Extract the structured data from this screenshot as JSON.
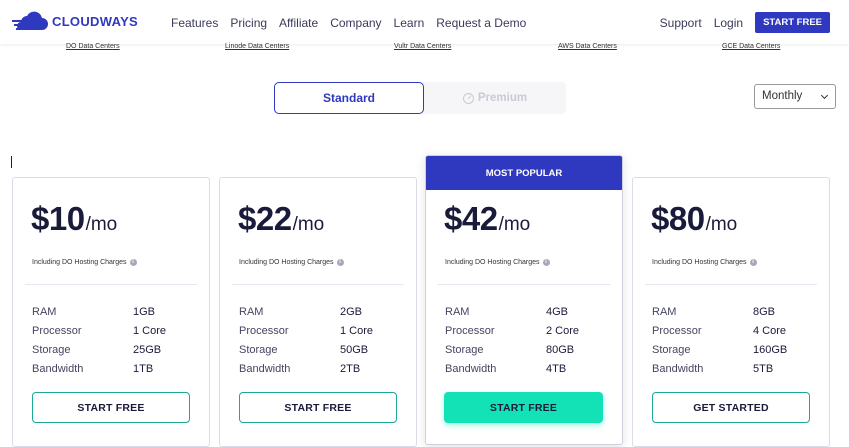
{
  "brand": {
    "name": "CLOUDWAYS",
    "color": "#2f39bf"
  },
  "nav": {
    "links": [
      "Features",
      "Pricing",
      "Affiliate",
      "Company",
      "Learn",
      "Request a Demo"
    ],
    "support": "Support",
    "login": "Login",
    "cta": "START FREE"
  },
  "datacenters": [
    "DO Data Centers",
    "Linode Data Centers",
    "Vultr Data Centers",
    "AWS Data Centers",
    "GCE Data Centers"
  ],
  "plan_toggle": {
    "standard": "Standard",
    "premium": "Premium",
    "premium_icon": "gauge-icon",
    "selected": "Standard"
  },
  "billing": {
    "selected": "Monthly",
    "icon": "chevron-down-icon"
  },
  "colors": {
    "primary": "#2f39bf",
    "accent": "#13e2b6"
  },
  "plans": [
    {
      "price": "$10",
      "unit": "/mo",
      "charges": "Including DO Hosting Charges",
      "specs": [
        [
          "RAM",
          "1GB"
        ],
        [
          "Processor",
          "1 Core"
        ],
        [
          "Storage",
          "25GB"
        ],
        [
          "Bandwidth",
          "1TB"
        ]
      ],
      "button": "START FREE"
    },
    {
      "price": "$22",
      "unit": "/mo",
      "charges": "Including DO Hosting Charges",
      "specs": [
        [
          "RAM",
          "2GB"
        ],
        [
          "Processor",
          "1 Core"
        ],
        [
          "Storage",
          "50GB"
        ],
        [
          "Bandwidth",
          "2TB"
        ]
      ],
      "button": "START FREE"
    },
    {
      "badge": "MOST POPULAR",
      "price": "$42",
      "unit": "/mo",
      "charges": "Including DO Hosting Charges",
      "specs": [
        [
          "RAM",
          "4GB"
        ],
        [
          "Processor",
          "2 Core"
        ],
        [
          "Storage",
          "80GB"
        ],
        [
          "Bandwidth",
          "4TB"
        ]
      ],
      "button": "START FREE"
    },
    {
      "price": "$80",
      "unit": "/mo",
      "charges": "Including DO Hosting Charges",
      "specs": [
        [
          "RAM",
          "8GB"
        ],
        [
          "Processor",
          "4 Core"
        ],
        [
          "Storage",
          "160GB"
        ],
        [
          "Bandwidth",
          "5TB"
        ]
      ],
      "button": "GET STARTED"
    }
  ]
}
